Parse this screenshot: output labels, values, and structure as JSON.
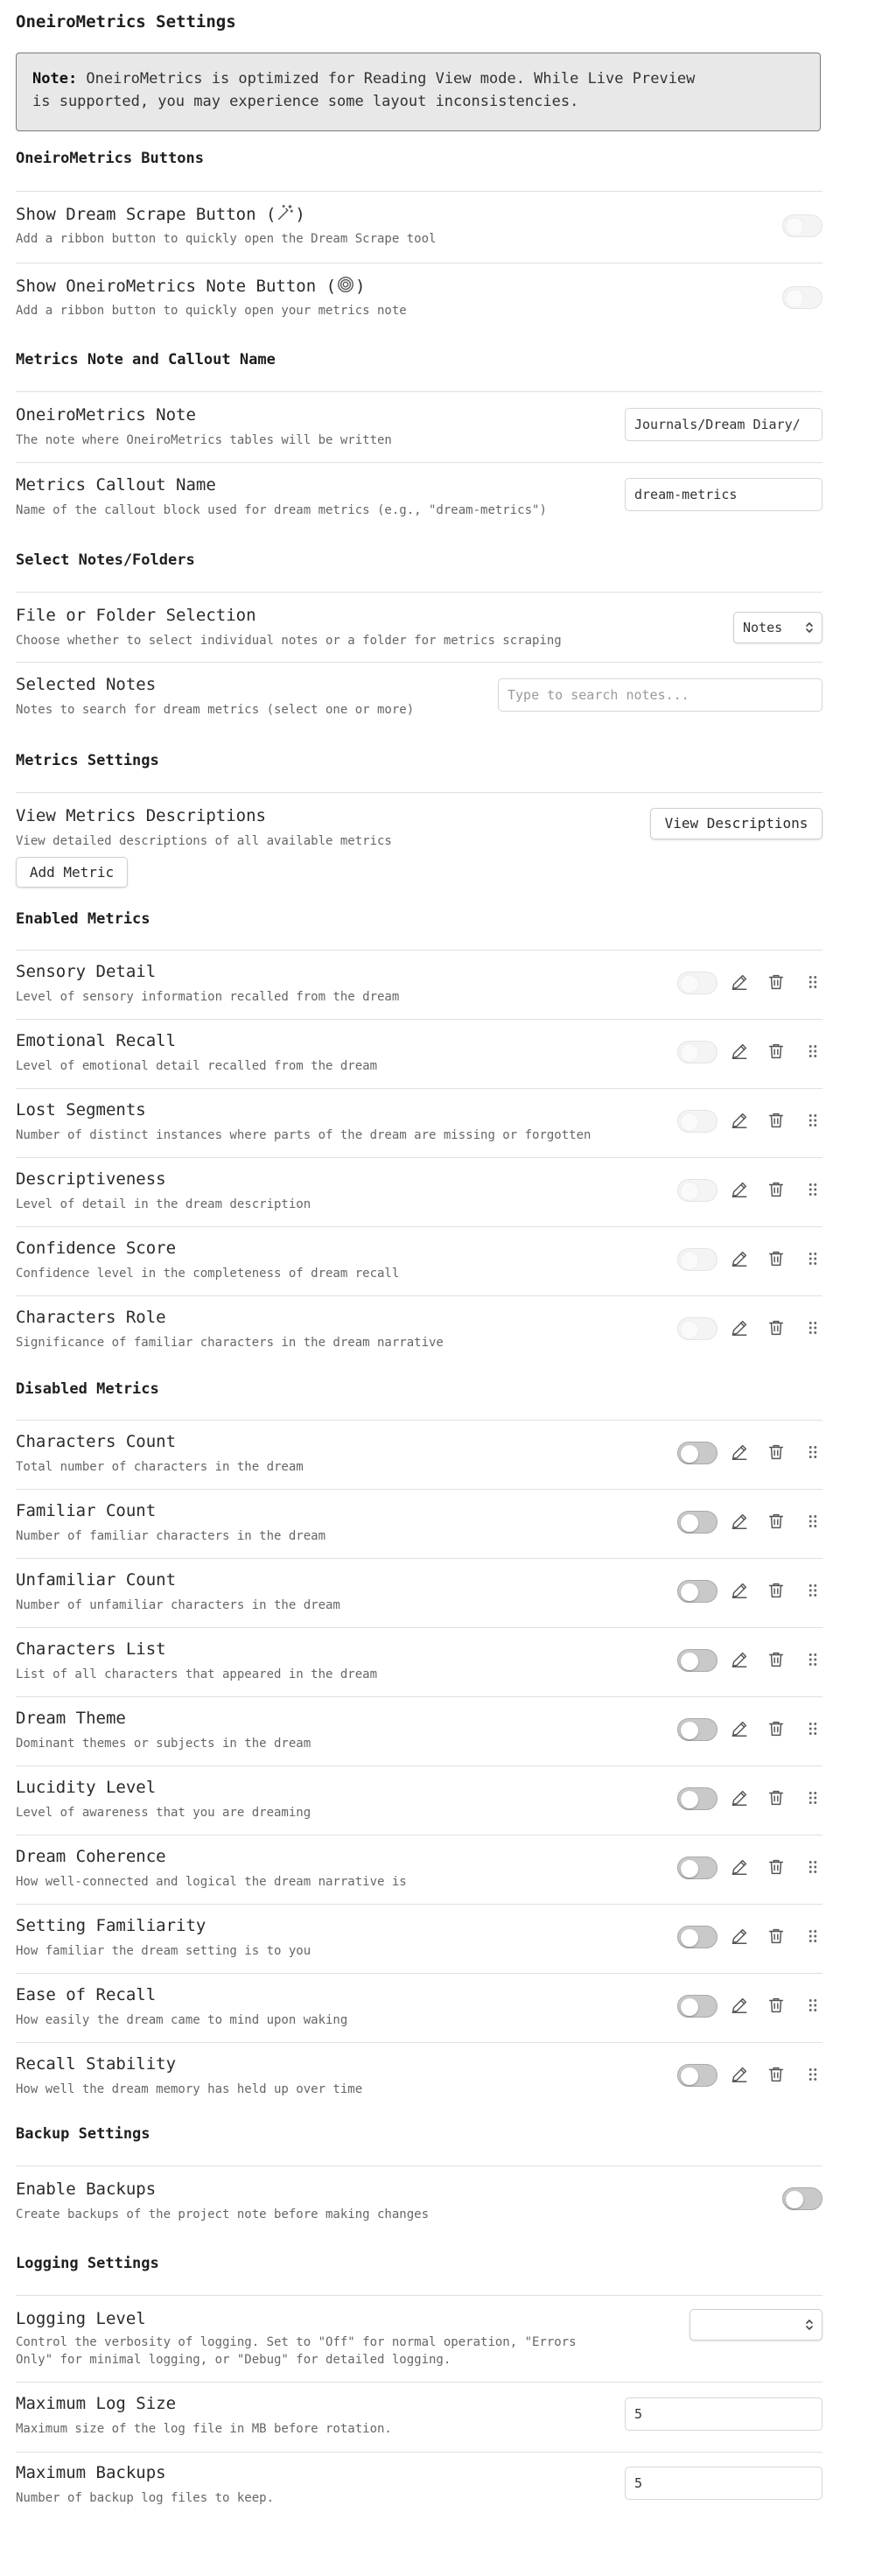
{
  "page_title": "OneiroMetrics Settings",
  "callout": {
    "label": "Note:",
    "text_line1": " OneiroMetrics is optimized for Reading View mode. While Live Preview",
    "text_line2": "is supported, you may experience some layout inconsistencies."
  },
  "sections": {
    "buttons": "OneiroMetrics Buttons",
    "note_callout": "Metrics Note and Callout Name",
    "select_notes": "Select Notes/Folders",
    "metrics_settings": "Metrics Settings",
    "enabled": "Enabled Metrics",
    "disabled": "Disabled Metrics",
    "backup": "Backup Settings",
    "logging": "Logging Settings"
  },
  "buttons": {
    "scrape": {
      "name_prefix": "Show Dream Scrape Button (",
      "name_suffix": ")",
      "desc": "Add a ribbon button to quickly open the Dream Scrape tool",
      "icon": "magic-wand-icon"
    },
    "note": {
      "name_prefix": "Show OneiroMetrics Note Button (",
      "name_suffix": ")",
      "desc": "Add a ribbon button to quickly open your metrics note",
      "icon": "spiral-icon"
    }
  },
  "note_settings": {
    "note": {
      "name": "OneiroMetrics Note",
      "desc": "The note where OneiroMetrics tables will be written",
      "value": "Journals/Dream Diary/"
    },
    "callout": {
      "name": "Metrics Callout Name",
      "desc": "Name of the callout block used for dream metrics (e.g., \"dream-metrics\")",
      "value": "dream-metrics"
    }
  },
  "select_settings": {
    "mode": {
      "name": "File or Folder Selection",
      "desc": "Choose whether to select individual notes or a folder for metrics scraping",
      "value": "Notes"
    },
    "selected": {
      "name": "Selected Notes",
      "desc": "Notes to search for dream metrics (select one or more)",
      "placeholder": "Type to search notes..."
    }
  },
  "metrics_settings": {
    "view": {
      "name": "View Metrics Descriptions",
      "desc": "View detailed descriptions of all available metrics",
      "button": "View Descriptions"
    },
    "add_button": "Add Metric"
  },
  "enabled_metrics": [
    {
      "name": "Sensory Detail",
      "desc": "Level of sensory information recalled from the dream"
    },
    {
      "name": "Emotional Recall",
      "desc": "Level of emotional detail recalled from the dream"
    },
    {
      "name": "Lost Segments",
      "desc": "Number of distinct instances where parts of the dream are missing or forgotten"
    },
    {
      "name": "Descriptiveness",
      "desc": "Level of detail in the dream description"
    },
    {
      "name": "Confidence Score",
      "desc": "Confidence level in the completeness of dream recall"
    },
    {
      "name": "Characters Role",
      "desc": "Significance of familiar characters in the dream narrative"
    }
  ],
  "disabled_metrics": [
    {
      "name": "Characters Count",
      "desc": "Total number of characters in the dream"
    },
    {
      "name": "Familiar Count",
      "desc": "Number of familiar characters in the dream"
    },
    {
      "name": "Unfamiliar Count",
      "desc": "Number of unfamiliar characters in the dream"
    },
    {
      "name": "Characters List",
      "desc": "List of all characters that appeared in the dream"
    },
    {
      "name": "Dream Theme",
      "desc": "Dominant themes or subjects in the dream"
    },
    {
      "name": "Lucidity Level",
      "desc": "Level of awareness that you are dreaming"
    },
    {
      "name": "Dream Coherence",
      "desc": "How well-connected and logical the dream narrative is"
    },
    {
      "name": "Setting Familiarity",
      "desc": "How familiar the dream setting is to you"
    },
    {
      "name": "Ease of Recall",
      "desc": "How easily the dream came to mind upon waking"
    },
    {
      "name": "Recall Stability",
      "desc": "How well the dream memory has held up over time"
    }
  ],
  "backup": {
    "name": "Enable Backups",
    "desc": "Create backups of the project note before making changes"
  },
  "logging": {
    "level": {
      "name": "Logging Level",
      "desc_line1": "Control the verbosity of logging. Set to \"Off\" for normal operation, \"Errors",
      "desc_line2": "Only\" for minimal logging, or \"Debug\" for detailed logging.",
      "value": ""
    },
    "size": {
      "name": "Maximum Log Size",
      "desc": "Maximum size of the log file in MB before rotation.",
      "value": "5"
    },
    "backups": {
      "name": "Maximum Backups",
      "desc": "Number of backup log files to keep.",
      "value": "5"
    }
  }
}
